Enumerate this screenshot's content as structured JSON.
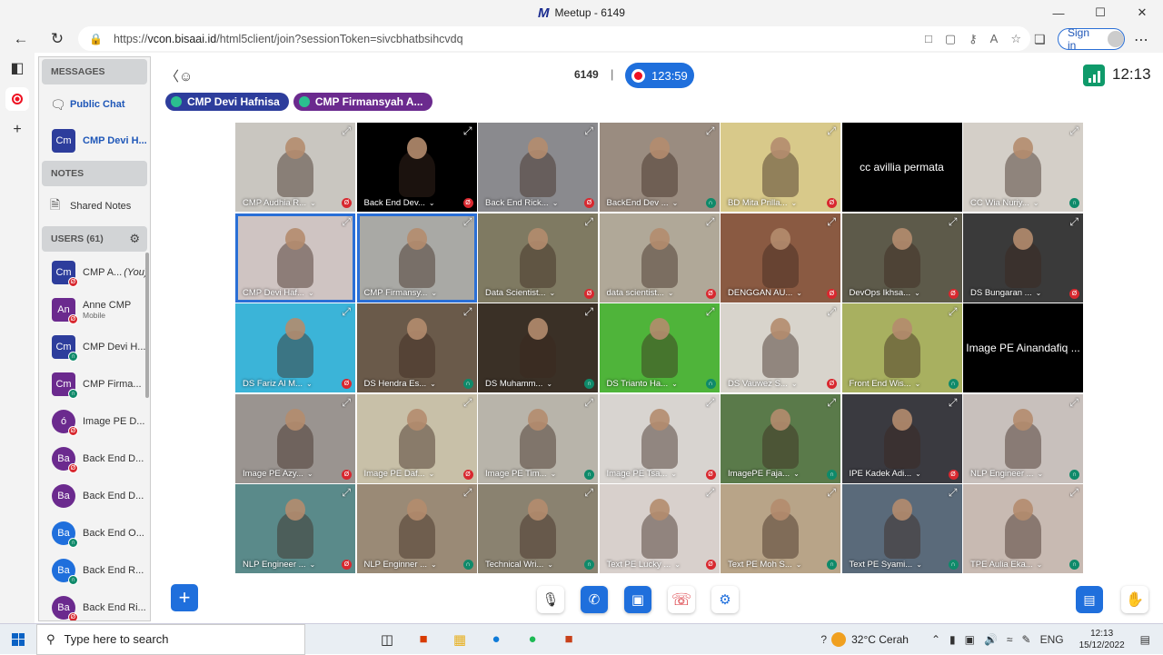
{
  "window": {
    "title": "Meetup - 6149",
    "logo": "M"
  },
  "browser": {
    "url_prefix": "https://",
    "url_host": "vcon.bisaai.id",
    "url_path": "/html5client/join?sessionToken=sivcbhatbsihcvdq",
    "signin_label": "Sign in"
  },
  "panel": {
    "messages_head": "MESSAGES",
    "public_chat": "Public Chat",
    "private_chat": {
      "initials": "Cm",
      "name": "CMP Devi H..."
    },
    "notes_head": "NOTES",
    "shared_notes": "Shared Notes",
    "users_head": "USERS (61)",
    "users": [
      {
        "initials": "Cm",
        "name": "CMP A...",
        "suffix": "(You)",
        "status": "muted",
        "color": "#2d3d9c",
        "shape": "square"
      },
      {
        "initials": "An",
        "name": "Anne CMP",
        "sub": "Mobile",
        "status": "muted",
        "color": "#6b2a8e",
        "shape": "square"
      },
      {
        "initials": "Cm",
        "name": "CMP Devi H...",
        "status": "listen",
        "color": "#2d3d9c",
        "shape": "square"
      },
      {
        "initials": "Cm",
        "name": "CMP Firma...",
        "status": "listen",
        "color": "#6b2a8e",
        "shape": "square"
      },
      {
        "initials": "ó",
        "name": "Image PE D...",
        "status": "muted",
        "color": "#6b2a8e",
        "shape": "round"
      },
      {
        "initials": "Ba",
        "name": "Back End D...",
        "status": "muted",
        "color": "#6b2a8e",
        "shape": "round"
      },
      {
        "initials": "Ba",
        "name": "Back End D...",
        "status": "none",
        "color": "#6b2a8e",
        "shape": "round"
      },
      {
        "initials": "Ba",
        "name": "Back End O...",
        "status": "listen",
        "color": "#1f6fdc",
        "shape": "round"
      },
      {
        "initials": "Ba",
        "name": "Back End R...",
        "status": "listen",
        "color": "#1f6fdc",
        "shape": "round"
      },
      {
        "initials": "Ba",
        "name": "Back End Ri...",
        "status": "muted",
        "color": "#6b2a8e",
        "shape": "round"
      }
    ]
  },
  "meeting": {
    "id": "6149",
    "separator": "|",
    "recording_time": "123:59",
    "clock": "12:13",
    "talkers": [
      {
        "name": "CMP Devi Hafnisa",
        "color": "#2d3d9c"
      },
      {
        "name": "CMP Firmansyah A...",
        "color": "#6b2a8e"
      }
    ]
  },
  "tiles": [
    {
      "label": "CMP Audhia R...",
      "status": "muted",
      "bg": "#c9c6c0"
    },
    {
      "label": "Back End Dev...",
      "status": "muted",
      "bg": "#000000"
    },
    {
      "label": "Back End Rick...",
      "status": "muted",
      "bg": "#8a8a8e"
    },
    {
      "label": "BackEnd Dev ...",
      "status": "listen",
      "bg": "#9a8c80"
    },
    {
      "label": "BD Mita Prilla...",
      "status": "muted",
      "bg": "#d8c98a"
    },
    {
      "label": "",
      "status": "none",
      "bg": "#000000",
      "center": "cc avillia permata"
    },
    {
      "label": "CC Wia Nuriy...",
      "status": "listen",
      "bg": "#d4cfc8"
    },
    {
      "label": "CMP Devi Haf...",
      "status": "none",
      "bg": "#cfc4c2",
      "active": true
    },
    {
      "label": "CMP Firmansy...",
      "status": "none",
      "bg": "#a9a9a5",
      "active": true
    },
    {
      "label": "Data Scientist...",
      "status": "muted",
      "bg": "#7f7a62"
    },
    {
      "label": "data scientist...",
      "status": "muted",
      "bg": "#b0a898"
    },
    {
      "label": "DENGGAN AU...",
      "status": "muted",
      "bg": "#8a5a42"
    },
    {
      "label": "DevOps Ikhsa...",
      "status": "muted",
      "bg": "#5d5a4a"
    },
    {
      "label": "DS Bungaran ...",
      "status": "muted",
      "bg": "#3a3a3a"
    },
    {
      "label": "DS Fariz Al M...",
      "status": "muted",
      "bg": "#3bb4d8"
    },
    {
      "label": "DS Hendra Es...",
      "status": "listen",
      "bg": "#6a5a4a"
    },
    {
      "label": "DS Muhamm...",
      "status": "listen",
      "bg": "#3a3026"
    },
    {
      "label": "DS Trianto Ha...",
      "status": "listen",
      "bg": "#4fb43a"
    },
    {
      "label": "DS Vauwez S...",
      "status": "muted",
      "bg": "#d8d4cc"
    },
    {
      "label": "Front End Wis...",
      "status": "listen",
      "bg": "#a8b060"
    },
    {
      "label": "",
      "status": "none",
      "bg": "#000000",
      "center": "Image PE Ainandafiq ..."
    },
    {
      "label": "Image PE Azy...",
      "status": "muted",
      "bg": "#9a9490"
    },
    {
      "label": "Image PE Daf...",
      "status": "muted",
      "bg": "#c8c0a8"
    },
    {
      "label": "Image PE Tim...",
      "status": "listen",
      "bg": "#b8b4aa"
    },
    {
      "label": "Image PE Tsa...",
      "status": "muted",
      "bg": "#d8d4d0"
    },
    {
      "label": "ImagePE Faja...",
      "status": "listen",
      "bg": "#5a7a4a"
    },
    {
      "label": "IPE Kadek Adi...",
      "status": "muted",
      "bg": "#3a3a40"
    },
    {
      "label": "NLP Engineer ...",
      "status": "listen",
      "bg": "#c8c0bc"
    },
    {
      "label": "NLP Engineer ...",
      "status": "muted",
      "bg": "#5a8a8a"
    },
    {
      "label": "NLP Enginner ...",
      "status": "listen",
      "bg": "#9a8a76"
    },
    {
      "label": "Technical Wri...",
      "status": "listen",
      "bg": "#8a8270"
    },
    {
      "label": "Text PE Lucky ...",
      "status": "muted",
      "bg": "#d8d0cc"
    },
    {
      "label": "Text PE Moh S...",
      "status": "listen",
      "bg": "#b8a488"
    },
    {
      "label": "Text PE Syami...",
      "status": "listen",
      "bg": "#5a6a7a"
    },
    {
      "label": "TPE Aulia Eka...",
      "status": "listen",
      "bg": "#c8bab2"
    }
  ],
  "taskbar": {
    "search_placeholder": "Type here to search",
    "weather": "32°C  Cerah",
    "lang": "ENG",
    "time": "12:13",
    "date": "15/12/2022"
  },
  "icons": {
    "back": "←",
    "refresh": "↻",
    "more": "⋯",
    "plus": "+",
    "expand": "⤢",
    "chevron": "⌄",
    "mic_off": "Ø",
    "listen": "∩",
    "gear": "⚙",
    "phone": "☎",
    "video": "■",
    "hangup": "☎",
    "settings": "⚙",
    "hand": "✋",
    "share": "▭"
  }
}
